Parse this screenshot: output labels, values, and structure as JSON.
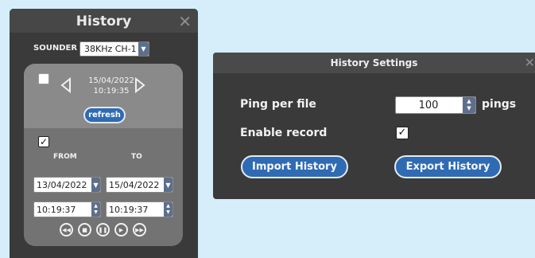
{
  "history_panel": {
    "title": "History",
    "close_glyph": "✕",
    "sounder_label": "SOUNDER",
    "sounder_value": "38KHz CH-1",
    "nav_date": "15/04/2022",
    "nav_time": "10:19:35",
    "refresh_label": "refresh",
    "top_checkbox_checked": false,
    "range_checkbox_checked": true,
    "from_label": "FROM",
    "to_label": "TO",
    "from_date": "13/04/2022",
    "to_date": "15/04/2022",
    "from_time": "10:19:37",
    "to_time": "10:19:37",
    "playback_icons": [
      "rewind-icon",
      "stop-icon",
      "pause-icon",
      "play-icon",
      "fast-forward-icon"
    ]
  },
  "settings_dialog": {
    "title": "History Settings",
    "close_glyph": "✕",
    "ping_per_file_label": "Ping per file",
    "ping_value": "100",
    "ping_unit": "pings",
    "enable_record_label": "Enable record",
    "enable_record_checked": true,
    "import_label": "Import History",
    "export_label": "Export History"
  },
  "colors": {
    "background": "#d6eefa",
    "panel": "#3a3a3a",
    "accent_button": "#2f6bb3",
    "spin_button": "#5e6f8c"
  }
}
